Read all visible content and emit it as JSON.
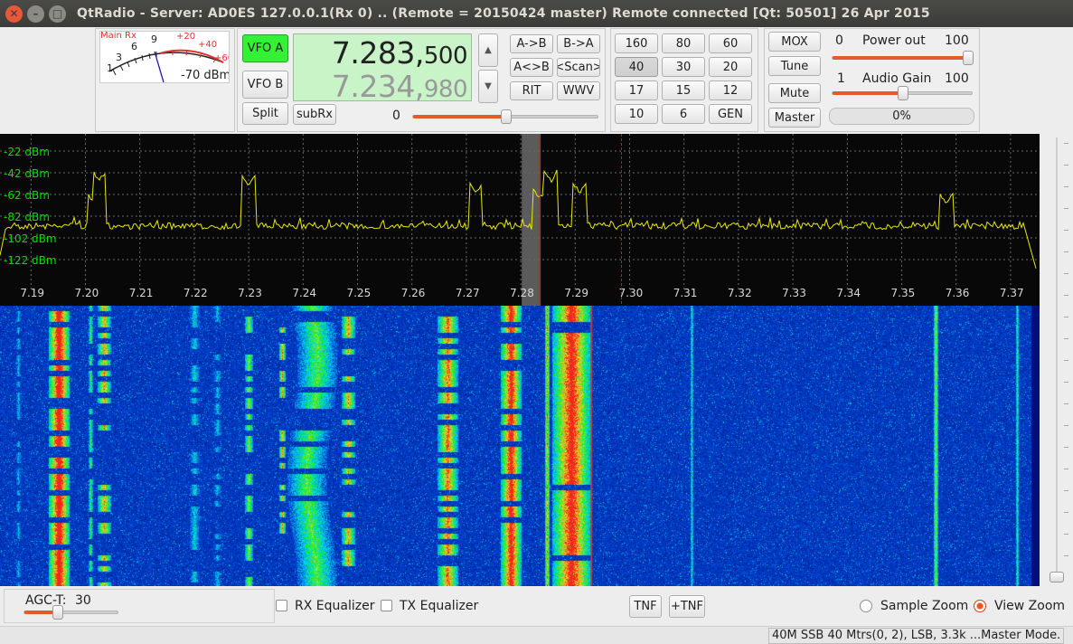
{
  "window": {
    "title": "QtRadio - Server: AD0ES 127.0.0.1(Rx 0) ..  (Remote = 20150424  master)  Remote connected  [Qt: 50501]  26 Apr 2015"
  },
  "meter": {
    "title": "Main Rx",
    "scale_black": [
      "1",
      "3",
      "6",
      "9"
    ],
    "scale_red": [
      "+20",
      "+40",
      "+60"
    ],
    "reading": "-70 dBm"
  },
  "vfo": {
    "vfo_a_label": "VFO A",
    "vfo_b_label": "VFO B",
    "split_label": "Split",
    "subrx_label": "subRx",
    "freq_a_main": "7.283,",
    "freq_a_small": "500",
    "freq_b_main": "7.234,",
    "freq_b_small": "980",
    "up_arrow": "▲",
    "down_arrow": "▼",
    "step_value": "0",
    "step_slider_fraction": 0.5
  },
  "vfo_ops": [
    "A->B",
    "B->A",
    "A<>B",
    "<Scan>",
    "RIT",
    "WWV"
  ],
  "bands": [
    "160",
    "80",
    "60",
    "40",
    "30",
    "20",
    "17",
    "15",
    "12",
    "10",
    "6",
    "GEN"
  ],
  "selected_band": "40",
  "tx": {
    "mox_label": "MOX",
    "tune_label": "Tune",
    "mute_label": "Mute",
    "master_label": "Master",
    "power_label": "Power out",
    "power_min": "0",
    "power_max": "100",
    "power_fraction": 1.0,
    "gain_label": "Audio Gain",
    "gain_min": "1",
    "gain_max": "100",
    "gain_fraction": 0.5,
    "progress_text": "0%",
    "progress_fraction": 0.0
  },
  "spectrum": {
    "db_labels": [
      "-22 dBm",
      "-42 dBm",
      "-62 dBm",
      "-82 dBm",
      "-102 dBm",
      "-122 dBm"
    ],
    "freq_labels": [
      "7.19",
      "7.20",
      "7.21",
      "7.22",
      "7.23",
      "7.24",
      "7.25",
      "7.26",
      "7.27",
      "7.28",
      "7.29",
      "7.30",
      "7.31",
      "7.32",
      "7.33",
      "7.34",
      "7.35",
      "7.36",
      "7.37"
    ],
    "trace_color": "#e8e800",
    "label_color": "#00dd00",
    "grid_color": "#6a6a6a",
    "passband_center": 7.2835,
    "vfo_b_marker": 7.2985,
    "peaks": [
      [
        7.2025,
        -60
      ],
      [
        7.2015,
        -80
      ],
      [
        7.23,
        -65
      ],
      [
        7.2718,
        -70
      ],
      [
        7.2855,
        -60
      ],
      [
        7.2835,
        -75
      ],
      [
        7.2908,
        -70
      ],
      [
        7.3582,
        -80
      ]
    ]
  },
  "bottom": {
    "agc_label": "AGC-T:",
    "agc_value": "30",
    "agc_fraction": 0.35,
    "rx_eq_label": "RX Equalizer",
    "tx_eq_label": "TX Equalizer",
    "tnf_label": "TNF",
    "plus_tnf_label": "+TNF",
    "sample_zoom_label": "Sample Zoom",
    "view_zoom_label": "View Zoom",
    "zoom_selected": "view"
  },
  "status": {
    "text": "40M SSB  40 Mtrs(0, 2), LSB, 3.3k  ...Master Mode."
  }
}
